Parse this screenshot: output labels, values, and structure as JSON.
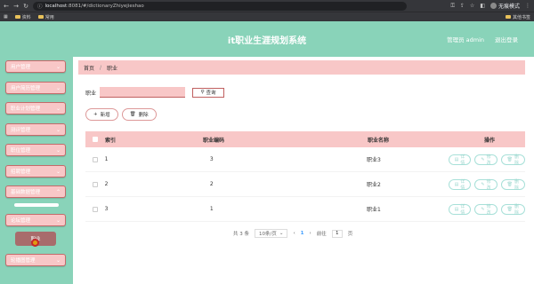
{
  "browser": {
    "host": "localhost",
    "url_rest": ":8081/#/dictionaryZhiyejieshao",
    "incognito_label": "无痕模式",
    "bookmarks": [
      "资料",
      "常用"
    ],
    "other_bookmarks": "其他书签"
  },
  "header": {
    "title": "it职业生涯规划系统",
    "admin_label": "管理员 admin",
    "logout_label": "退出登录"
  },
  "sidebar": {
    "items": [
      {
        "label": "用户管理"
      },
      {
        "label": "用户简历管理"
      },
      {
        "label": "职业计划管理"
      },
      {
        "label": "测评管理"
      },
      {
        "label": "职位管理"
      },
      {
        "label": "招聘管理"
      },
      {
        "label": "基础数据管理"
      },
      {
        "label": "论坛管理"
      },
      {
        "label": "轮播图管理"
      }
    ],
    "active_label": "职业"
  },
  "breadcrumb": {
    "home": "首页",
    "current": "职业"
  },
  "search": {
    "label": "职业",
    "placeholder": "",
    "button": "查询"
  },
  "actions": {
    "add": "新增",
    "delete": "删除"
  },
  "table": {
    "headers": {
      "index": "索引",
      "code": "职业编码",
      "name": "职业名称",
      "ops": "操作"
    },
    "rows": [
      {
        "index": "1",
        "code": "3",
        "name": "职业3"
      },
      {
        "index": "2",
        "code": "2",
        "name": "职业2"
      },
      {
        "index": "3",
        "code": "1",
        "name": "职业1"
      }
    ],
    "op_labels": {
      "detail": "详情",
      "edit": "修改",
      "delete": "删除"
    }
  },
  "pagination": {
    "total": "共 3 条",
    "page_size": "10条/页",
    "current_page": "1",
    "goto_label": "前往",
    "goto_value": "1",
    "page_suffix": "页"
  },
  "colors": {
    "header_bg": "#89d3b9",
    "pink": "#f8c7c7",
    "accent": "#409eff"
  }
}
